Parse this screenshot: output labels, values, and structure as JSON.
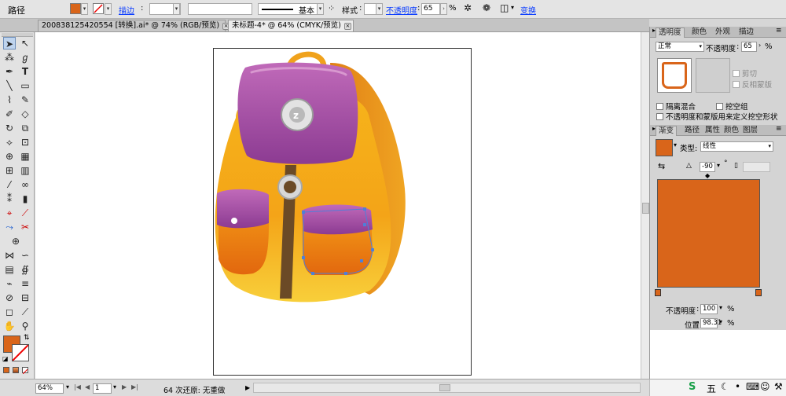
{
  "control_bar": {
    "object_type": "路径",
    "stroke_label": "描边",
    "stroke_style": "基本",
    "style_label": "样式",
    "opacity_label": "不透明度",
    "opacity_value": "65",
    "percent": "%",
    "transform_label": "变换",
    "fill_color": "#d9651a"
  },
  "doc_tabs": [
    {
      "label": "200838125420554 [转换].ai* @ 74% (RGB/预览)"
    },
    {
      "label": "未标题-4* @ 64% (CMYK/预览)"
    }
  ],
  "transparency_panel": {
    "tabs": [
      "透明度",
      "颜色",
      "外观",
      "描边"
    ],
    "blend_mode": "正常",
    "opacity_label": "不透明度",
    "opacity_value": "65",
    "percent": "%",
    "clip_label": "剪切",
    "invert_mask_label": "反相蒙版",
    "isolate_blending_label": "隔离混合",
    "knockout_group_label": "挖空组",
    "opacity_mask_label": "不透明度和蒙版用来定义挖空形状"
  },
  "gradient_panel": {
    "tabs": [
      "渐变",
      "路径",
      "属性",
      "颜色",
      "图层"
    ],
    "type_label": "类型:",
    "type_value": "线性",
    "angle_value": "-90",
    "degree": "°",
    "opacity_label": "不透明度",
    "opacity_value": "100",
    "location_label": "位置",
    "location_value": "98.31",
    "percent": "%",
    "ramp_color": "#d9651a"
  },
  "status_bar": {
    "zoom": "64%",
    "page": "1",
    "status_text": "64 次还原: 无重做"
  },
  "tray": {
    "ime_label": "五"
  }
}
